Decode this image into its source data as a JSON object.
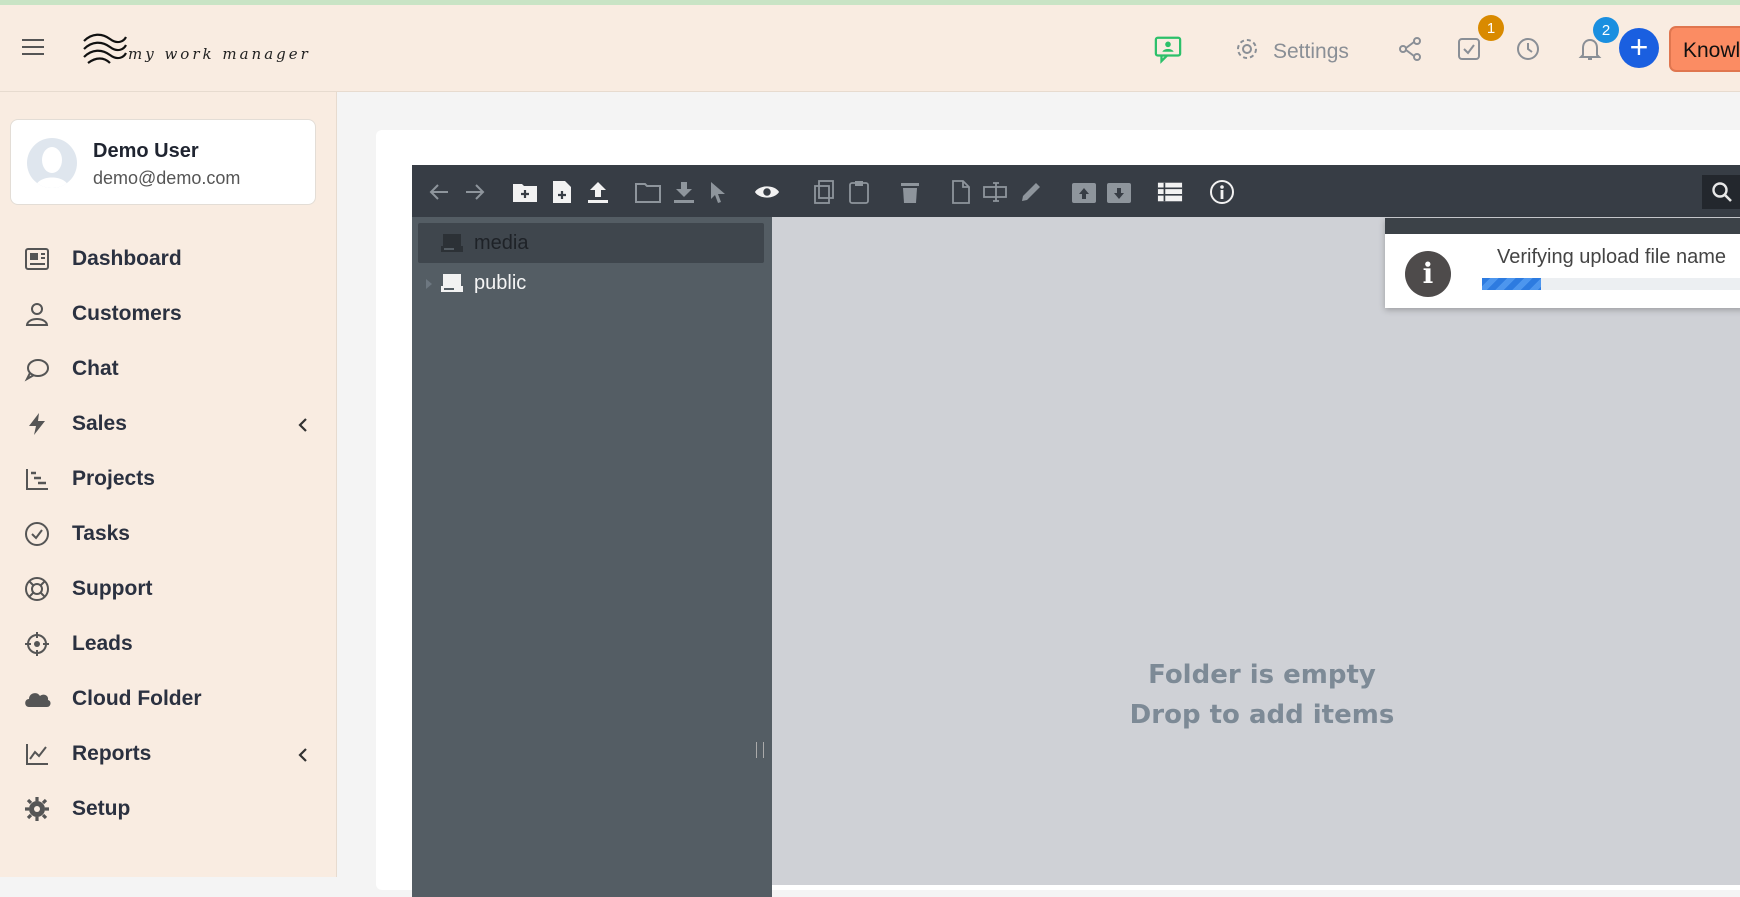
{
  "header": {
    "logo_text": "my work manager",
    "settings_label": "Settings",
    "tasks_badge": "1",
    "notifications_badge": "2",
    "add_label": "+",
    "knowledge_button": "Knowl"
  },
  "user": {
    "name": "Demo User",
    "email": "demo@demo.com"
  },
  "sidebar": {
    "items": [
      {
        "label": "Dashboard",
        "icon": "dashboard-icon"
      },
      {
        "label": "Customers",
        "icon": "user-icon"
      },
      {
        "label": "Chat",
        "icon": "chat-icon"
      },
      {
        "label": "Sales",
        "icon": "bolt-icon",
        "expandable": true
      },
      {
        "label": "Projects",
        "icon": "projects-icon"
      },
      {
        "label": "Tasks",
        "icon": "check-circle-icon"
      },
      {
        "label": "Support",
        "icon": "lifebuoy-icon"
      },
      {
        "label": "Leads",
        "icon": "crosshair-icon"
      },
      {
        "label": "Cloud Folder",
        "icon": "cloud-icon"
      },
      {
        "label": "Reports",
        "icon": "line-chart-icon",
        "expandable": true
      },
      {
        "label": "Setup",
        "icon": "gear-icon"
      }
    ]
  },
  "file_manager": {
    "tree": [
      {
        "label": "media",
        "selected": true
      },
      {
        "label": "public",
        "selected": false
      }
    ],
    "empty_line1": "Folder is empty",
    "empty_line2": "Drop to add items"
  },
  "toast": {
    "message": "Verifying upload file name",
    "progress": 0.22
  },
  "colors": {
    "header_bg": "#f9ece1",
    "accent_blue": "#1a5fe0",
    "badge_orange": "#d98a00",
    "badge_blue": "#1a8fe0",
    "cta_orange": "#fb8c63",
    "chat_green": "#2cc06a"
  }
}
